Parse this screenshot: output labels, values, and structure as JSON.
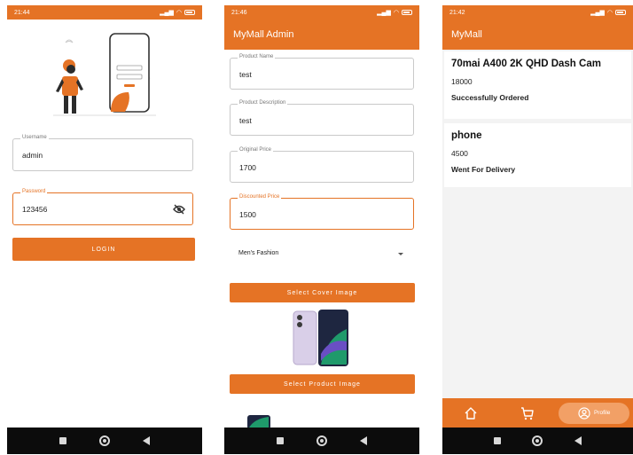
{
  "colors": {
    "brand": "#e57325",
    "nav_bar": "#0c0c0c"
  },
  "login_screen": {
    "status_time": "21:44",
    "username": {
      "label": "Username",
      "value": "admin"
    },
    "password": {
      "label": "Password",
      "value": "123456",
      "toggle_icon": "eye-off-icon"
    },
    "login_button": "LOGIN"
  },
  "admin_screen": {
    "status_time": "21:46",
    "app_title": "MyMall Admin",
    "fields": [
      {
        "label": "Product Name",
        "value": "test"
      },
      {
        "label": "Product Description",
        "value": "test"
      },
      {
        "label": "Original Price",
        "value": "1700"
      },
      {
        "label": "Discounted Price",
        "value": "1500"
      }
    ],
    "category_dropdown": {
      "selected": "Men's Fashion",
      "icon": "chevron-down-icon"
    },
    "cover_image_button": "Select Cover Image",
    "product_image_button": "Select Product Image"
  },
  "orders_screen": {
    "status_time": "21:42",
    "app_title": "MyMall",
    "orders": [
      {
        "title": "70mai A400 2K QHD Dash Cam",
        "price": "18000",
        "status": "Successfully Ordered"
      },
      {
        "title": "phone",
        "price": "4500",
        "status": "Went For Delivery"
      }
    ],
    "bottom_nav": {
      "home_icon": "home-icon",
      "cart_icon": "cart-icon",
      "profile_icon": "profile-icon",
      "profile_label": "Profile"
    }
  }
}
